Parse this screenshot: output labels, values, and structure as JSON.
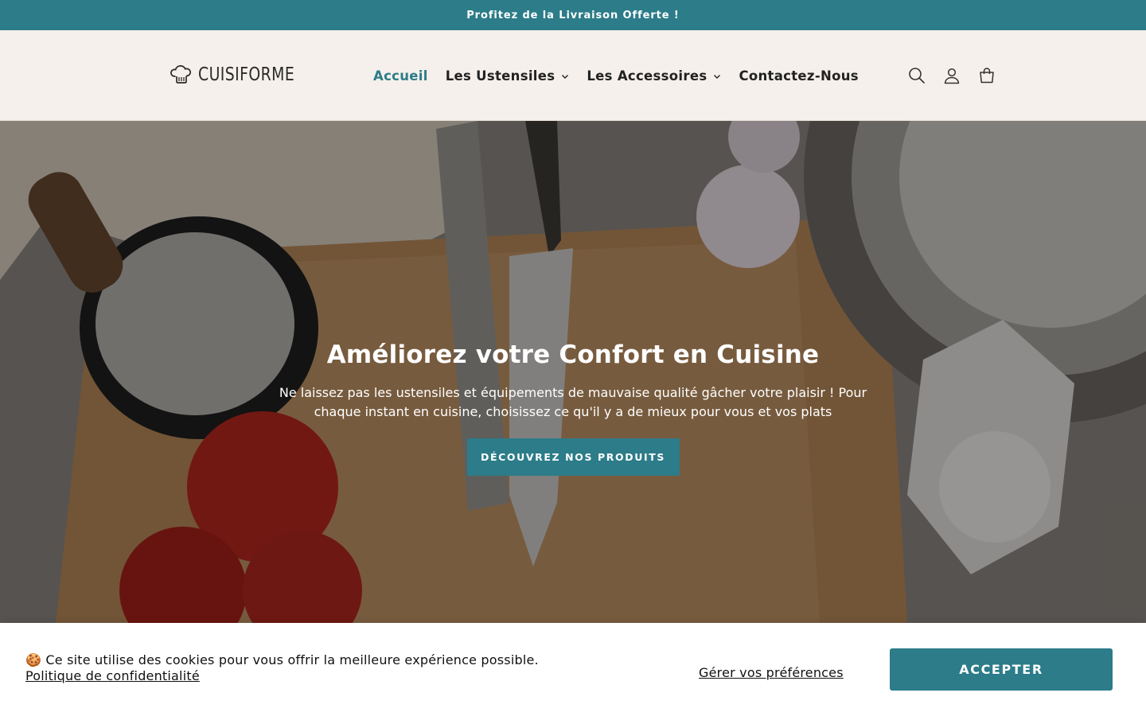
{
  "announcement": {
    "text": "Profitez de la Livraison Offerte !"
  },
  "header": {
    "logo_text": "CUISIFORME",
    "nav": [
      {
        "label": "Accueil",
        "active": true,
        "has_dropdown": false
      },
      {
        "label": "Les Ustensiles",
        "active": false,
        "has_dropdown": true
      },
      {
        "label": "Les Accessoires",
        "active": false,
        "has_dropdown": true
      },
      {
        "label": "Contactez-Nous",
        "active": false,
        "has_dropdown": false
      }
    ],
    "icons": [
      "search-icon",
      "account-icon",
      "cart-icon"
    ]
  },
  "hero": {
    "title": "Améliorez votre Confort en Cuisine",
    "subtitle": "Ne laissez pas les ustensiles et équipements de mauvaise qualité gâcher votre plaisir ! Pour chaque instant en cuisine, choisissez ce qu'il y a de mieux pour vous et vos plats",
    "button_label": "DÉCOUVREZ NOS PRODUITS"
  },
  "cookie_banner": {
    "message": "🍪 Ce site utilise des cookies pour vous offrir la meilleure expérience possible.",
    "privacy_link": "Politique de confidentialité",
    "preferences_label": "Gérer vos préférences",
    "accept_label": "ACCEPTER"
  },
  "colors": {
    "accent": "#2c7c89",
    "header_bg": "#f5f0eb",
    "text_dark": "#222222"
  }
}
